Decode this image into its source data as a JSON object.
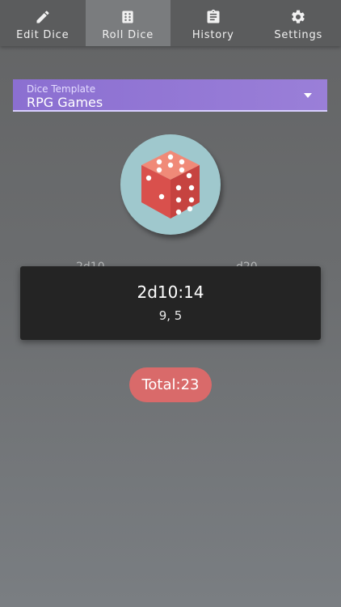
{
  "tabs": [
    {
      "label": "Edit Dice",
      "icon": "pencil-icon",
      "active": false
    },
    {
      "label": "Roll Dice",
      "icon": "dice-icon",
      "active": true
    },
    {
      "label": "History",
      "icon": "clipboard-icon",
      "active": false
    },
    {
      "label": "Settings",
      "icon": "gear-icon",
      "active": false
    }
  ],
  "template": {
    "hint": "Dice Template",
    "value": "RPG Games"
  },
  "dice_peek": {
    "left": "2d10",
    "right": "d20"
  },
  "toast": {
    "title": "2d10:14",
    "detail": "9, 5"
  },
  "total": {
    "label": "Total:23"
  },
  "colors": {
    "accent": "#9a7fd8",
    "total": "#d96a6a",
    "dice_bg": "#9fc8cd",
    "dice": "#d9504c"
  }
}
